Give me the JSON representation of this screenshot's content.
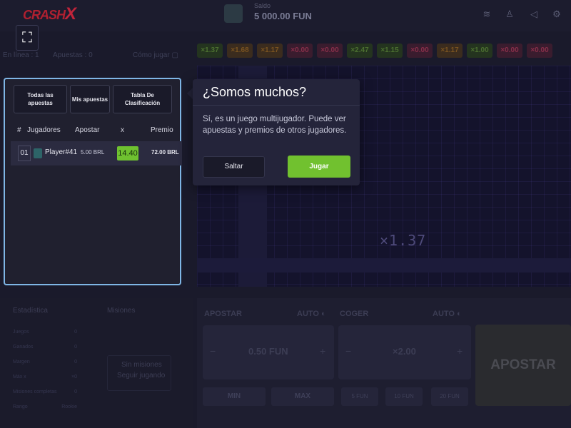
{
  "header": {
    "logo_main": "CRASH",
    "logo_x": "X",
    "balance_label": "Saldo",
    "balance_value": "5 000.00 FUN"
  },
  "stats_line": {
    "online": "En línea : 1",
    "bets": "Apuestas : 0",
    "how_to_play": "Cómo jugar"
  },
  "multipliers": [
    {
      "v": "×1.37",
      "c": "green"
    },
    {
      "v": "×1.68",
      "c": "orange"
    },
    {
      "v": "×1.17",
      "c": "orange"
    },
    {
      "v": "×0.00",
      "c": "red"
    },
    {
      "v": "×0.00",
      "c": "red"
    },
    {
      "v": "×2.47",
      "c": "green"
    },
    {
      "v": "×1.15",
      "c": "green"
    },
    {
      "v": "×0.00",
      "c": "red"
    },
    {
      "v": "×1.17",
      "c": "orange"
    },
    {
      "v": "×1.00",
      "c": "green"
    },
    {
      "v": "×0.00",
      "c": "red"
    },
    {
      "v": "×0.00",
      "c": "red"
    }
  ],
  "game": {
    "current_multiplier": "×1.37"
  },
  "leaderboard": {
    "tabs": {
      "all_bets": "Todas las apuestas",
      "my_bets": "Mis apuestas",
      "leaderboard": "Tabla De Clasificación"
    },
    "columns": {
      "num": "#",
      "players": "Jugadores",
      "bet": "Apostar",
      "mult": "x",
      "prize": "Premio"
    },
    "rows": [
      {
        "num": "01",
        "player": "Player#41",
        "bet": "5.00 BRL",
        "mult": "14.40",
        "prize": "72.00 BRL"
      }
    ]
  },
  "popup": {
    "title": "¿Somos muchos?",
    "text": "Sí, es un juego multijugador. Puede ver apuestas y premios de otros jugadores.",
    "skip": "Saltar",
    "play": "Jugar"
  },
  "stats_panel": {
    "title": "Estadística",
    "missions_title": "Misiones",
    "rows": [
      {
        "label": "Juegos",
        "value": "0"
      },
      {
        "label": "Ganados",
        "value": "0"
      },
      {
        "label": "Margen",
        "value": "0"
      },
      {
        "label": "Máx x",
        "value": "×0"
      },
      {
        "label": "Misiones completas",
        "value": "0"
      },
      {
        "label": "Rango",
        "value": "Rookie"
      }
    ],
    "no_missions": "Sin misiones",
    "keep_playing": "Seguir jugando"
  },
  "bet_controls": {
    "bet_label": "APOSTAR",
    "auto1": "AUTO",
    "cashout_label": "COGER",
    "auto2": "AUTO",
    "minus": "−",
    "plus": "+",
    "bet_value": "0.50 FUN",
    "cashout_value": "×2.00",
    "min": "MIN",
    "max": "MAX",
    "q1": "5 FUN",
    "q2": "10 FUN",
    "q3": "20 FUN",
    "submit": "APOSTAR"
  }
}
